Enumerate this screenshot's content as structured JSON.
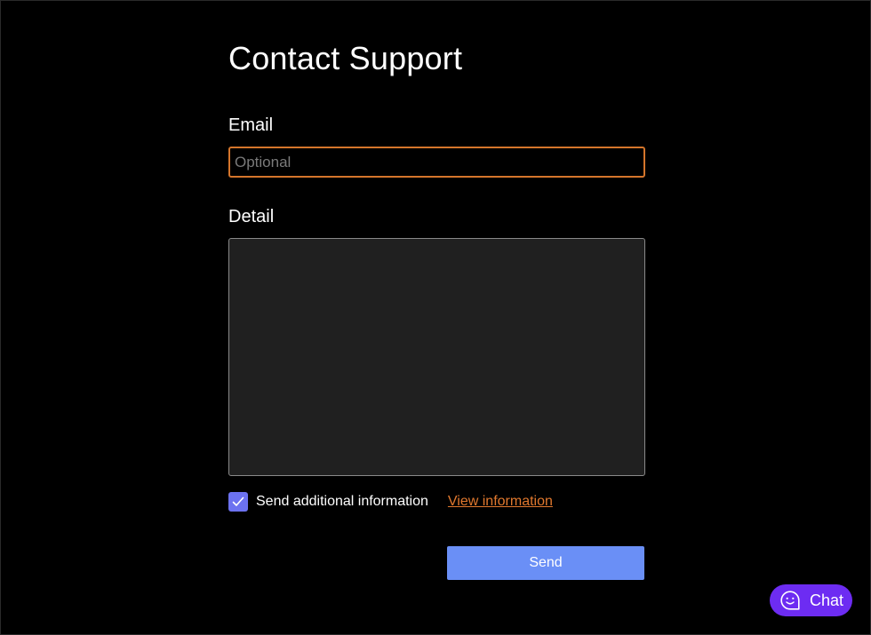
{
  "page": {
    "title": "Contact Support"
  },
  "email": {
    "label": "Email",
    "placeholder": "Optional",
    "value": ""
  },
  "detail": {
    "label": "Detail",
    "value": ""
  },
  "additional_info": {
    "checked": true,
    "label": "Send additional information",
    "link_label": "View information"
  },
  "actions": {
    "send_label": "Send"
  },
  "chat": {
    "label": "Chat",
    "icon": "chat-smiley-icon"
  },
  "colors": {
    "background": "#000000",
    "email_border_focus": "#d4752b",
    "link": "#e0782e",
    "checkbox": "#6c72f0",
    "send_button": "#6a8ff6",
    "chat_button": "#6d2cf2",
    "detail_background": "#202020"
  }
}
